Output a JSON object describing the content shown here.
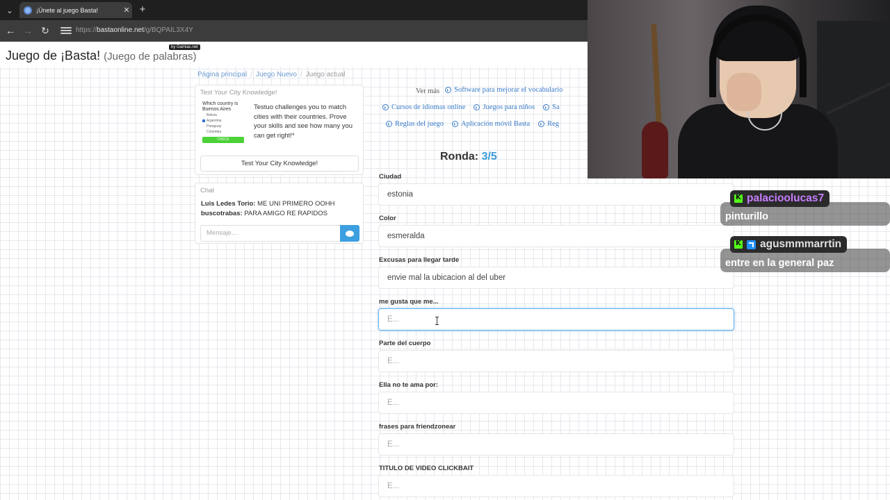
{
  "browser": {
    "tab_title": "¡Únete al juego Basta!",
    "new_tab_label": "+",
    "url_prefix": "https://",
    "url_host": "bastaonline.net",
    "url_path": "/g/BQPAIL3X4Y"
  },
  "site": {
    "title": "Juego de ¡Basta!",
    "subtitle": "(Juego de palabras)",
    "by_badge": "by Gamiac.net"
  },
  "breadcrumb": {
    "items": [
      "Página principal",
      "Juego Nuevo",
      "Juego actual"
    ],
    "separator": "/"
  },
  "ad": {
    "heading": "Test Your City Knowledge!",
    "image_question": "Which country is Buenos Aires",
    "image_options": [
      "Bolivia",
      "Argentina",
      "Paraguay",
      "Colombia"
    ],
    "image_button": "CHECK",
    "text": "Testuo challenges you to match cities with their countries. Prove your skills and see how many you can get right!*",
    "button_label": "Test Your City Knowledge!"
  },
  "chat": {
    "heading": "Chat",
    "messages": [
      {
        "user": "Luis Ledes Torio:",
        "text": " ME UNI PRIMERO OOHH"
      },
      {
        "user": "buscotrabas:",
        "text": " PARA AMIGO RE RAPIDOS"
      }
    ],
    "input_placeholder": "Mensaje....",
    "send_icon": "speech-bubble-icon"
  },
  "more_links": {
    "ver_mas": "Ver más",
    "row1": [
      "Software para mejorar el vocabulario"
    ],
    "row2": [
      "Cursos de idiomas online",
      "Juegos para niños",
      "Sa"
    ],
    "row3": [
      "Reglas del juego",
      "Aplicación móvil Basta",
      "Reg"
    ]
  },
  "round": {
    "label": "Ronda:",
    "value": "3/5"
  },
  "fields": [
    {
      "label": "Ciudad",
      "value": "estonia",
      "placeholder": ""
    },
    {
      "label": "Color",
      "value": "esmeralda",
      "placeholder": ""
    },
    {
      "label": "Excusas para llegar tarde",
      "value": "envie mal la ubicacion al del uber",
      "placeholder": ""
    },
    {
      "label": "me gusta que me...",
      "value": "",
      "placeholder": "E..."
    },
    {
      "label": "Parte del cuerpo",
      "value": "",
      "placeholder": "E..."
    },
    {
      "label": "Ella no te ama por:",
      "value": "",
      "placeholder": "E..."
    },
    {
      "label": "frases para friendzonear",
      "value": "",
      "placeholder": "E..."
    },
    {
      "label": "TITULO DE VIDEO CLICKBAIT",
      "value": "",
      "placeholder": "E..."
    }
  ],
  "stream_chat": [
    {
      "user": "palacioolucas7",
      "user_color": "#c77dff",
      "message": "pinturillo",
      "badges": [
        "kick"
      ]
    },
    {
      "user": "agusmmmarrtin",
      "user_color": "#e0e0e0",
      "message": "entre en la general paz",
      "badges": [
        "kick",
        "subscriber"
      ]
    }
  ],
  "colors": {
    "link": "#3a7bc8",
    "round_value": "#3a9ad9",
    "send_button": "#3c9fe0",
    "kick_green": "#53fc18"
  }
}
